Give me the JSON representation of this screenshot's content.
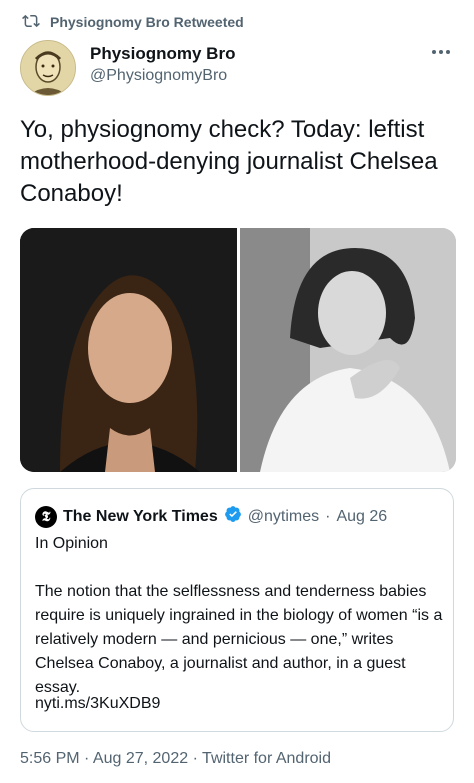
{
  "retweet": {
    "icon": "retweet-icon",
    "label": "Physiognomy Bro Retweeted"
  },
  "author": {
    "display_name": "Physiognomy Bro",
    "handle": "@PhysiognomyBro",
    "more_icon": "more-icon"
  },
  "tweet": {
    "text": "Yo, physiognomy check? Today: leftist motherhood-denying journalist Chelsea Conaboy!"
  },
  "quote": {
    "name": "The New York Times",
    "handle": "@nytimes",
    "separator": "·",
    "date": "Aug 26",
    "label": "In Opinion",
    "body": "The notion that the selflessness and tenderness babies require is uniquely ingrained in the biology of women “is a relatively modern — and pernicious — one,” writes Chelsea Conaboy, a journalist and author, in a guest essay.",
    "link": "nyti.ms/3KuXDB9"
  },
  "meta": {
    "timestamp": "5:56 PM · Aug 27, 2022 · Twitter for Android"
  },
  "colors": {
    "secondary_text": "#536471",
    "verified_blue": "#1d9bf0",
    "border": "#cfd9de"
  }
}
